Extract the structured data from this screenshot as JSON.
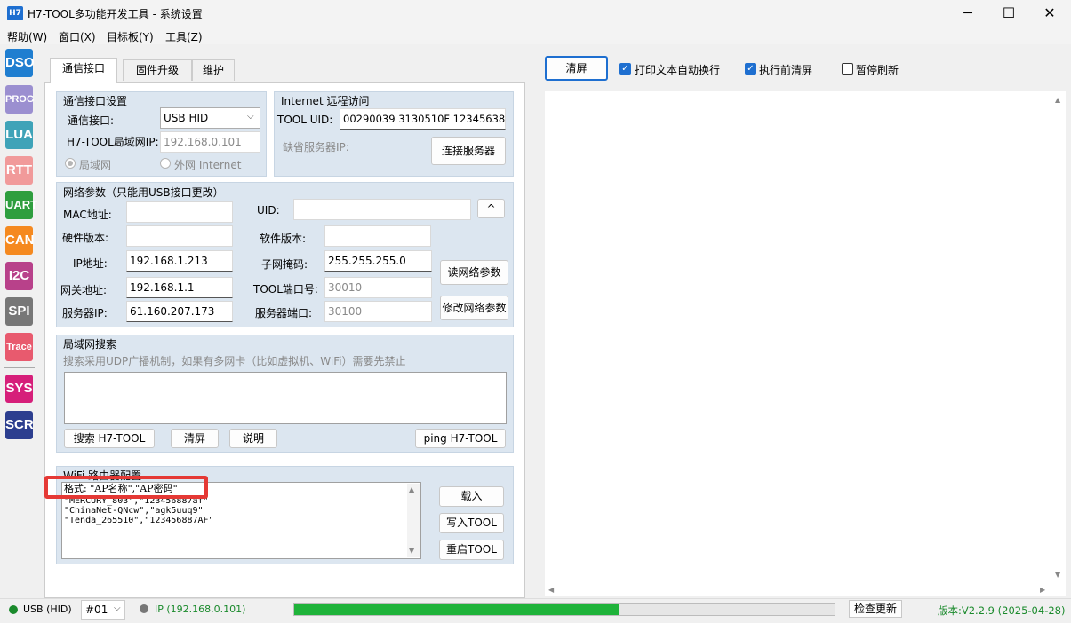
{
  "window": {
    "icon_label": "H7",
    "title": "H7-TOOL多功能开发工具 - 系统设置",
    "minimize": "─",
    "maximize": "☐",
    "close": "✕"
  },
  "menu": [
    "帮助(W)",
    "窗口(X)",
    "目标板(Y)",
    "工具(Z)"
  ],
  "toolbar": [
    {
      "label": "DSO",
      "color": "#1f7ed0"
    },
    {
      "label": "PROG",
      "color": "#9b8fd0"
    },
    {
      "label": "LUA",
      "color": "#3fa3b8"
    },
    {
      "label": "RTT",
      "color": "#f19a9a"
    },
    {
      "label": "UART",
      "color": "#2e9e3e"
    },
    {
      "label": "CAN",
      "color": "#f5891f"
    },
    {
      "label": "I2C",
      "color": "#b8418a"
    },
    {
      "label": "SPI",
      "color": "#777777"
    },
    {
      "label": "Trace",
      "color": "#e85a6e"
    },
    {
      "label": "SYS",
      "color": "#d61f7a"
    },
    {
      "label": "SCR",
      "color": "#2c3e8f"
    }
  ],
  "tabs": [
    "通信接口",
    "固件升级",
    "维护"
  ],
  "comm": {
    "title": "通信接口设置",
    "port_label": "通信接口:",
    "port_value": "USB HID",
    "lan_ip_label": "H7-TOOL局域网IP:",
    "lan_ip_value": "192.168.0.101",
    "radio_lan": "局域网",
    "radio_wan": "外网 Internet"
  },
  "internet": {
    "title": "Internet 远程访问",
    "uid_label": "TOOL UID:",
    "uid_value": "00290039 3130510F 12345638",
    "server_label": "缺省服务器IP:",
    "connect_button": "连接服务器"
  },
  "net": {
    "title": "网络参数（只能用USB接口更改）",
    "mac_label": "MAC地址:",
    "uid_label": "UID:",
    "uid_button": "^",
    "hw_label": "硬件版本:",
    "sw_label": "软件版本:",
    "ip_label": "IP地址:",
    "ip_value": "192.168.1.213",
    "mask_label": "子网掩码:",
    "mask_value": "255.255.255.0",
    "gw_label": "网关地址:",
    "gw_value": "192.168.1.1",
    "port_label": "TOOL端口号:",
    "port_value": "30010",
    "srv_ip_label": "服务器IP:",
    "srv_ip_value": "61.160.207.173",
    "srv_port_label": "服务器端口:",
    "srv_port_value": "30100",
    "read_button": "读网络参数",
    "modify_button": "修改网络参数"
  },
  "lan_search": {
    "title": "局域网搜索",
    "hint": "搜索采用UDP广播机制，如果有多网卡（比如虚拟机、WiFi）需要先禁止",
    "search_button": "搜索 H7-TOOL",
    "clear_button": "清屏",
    "help_button": "说明",
    "ping_button": "ping H7-TOOL"
  },
  "wifi": {
    "title": "WiFi 路由器配置",
    "lines": [
      "格式: \"AP名称\",\"AP密码\"",
      "\"MERCURY_803\",\"123456887af\"",
      "\"ChinaNet-QNcw\",\"agk5uuq9\"",
      "\"Tenda_265510\",\"123456887AF\""
    ],
    "load_button": "载入",
    "write_button": "写入TOOL",
    "restart_button": "重启TOOL"
  },
  "output_toolbar": {
    "clear_button": "清屏",
    "wrap_label": "打印文本自动换行",
    "wrap_checked": true,
    "preclear_label": "执行前清屏",
    "preclear_checked": true,
    "pause_label": "暂停刷新",
    "pause_checked": false
  },
  "status": {
    "usb": "USB (HID)",
    "device": "#01",
    "ip": "IP (192.168.0.101)",
    "progress": 0.6,
    "check_update": "检查更新",
    "version": "版本:V2.2.9 (2025-04-28)",
    "colors": {
      "ok": "#1a8a2c",
      "idle": "#777777",
      "progress": "#1fb33a"
    }
  }
}
